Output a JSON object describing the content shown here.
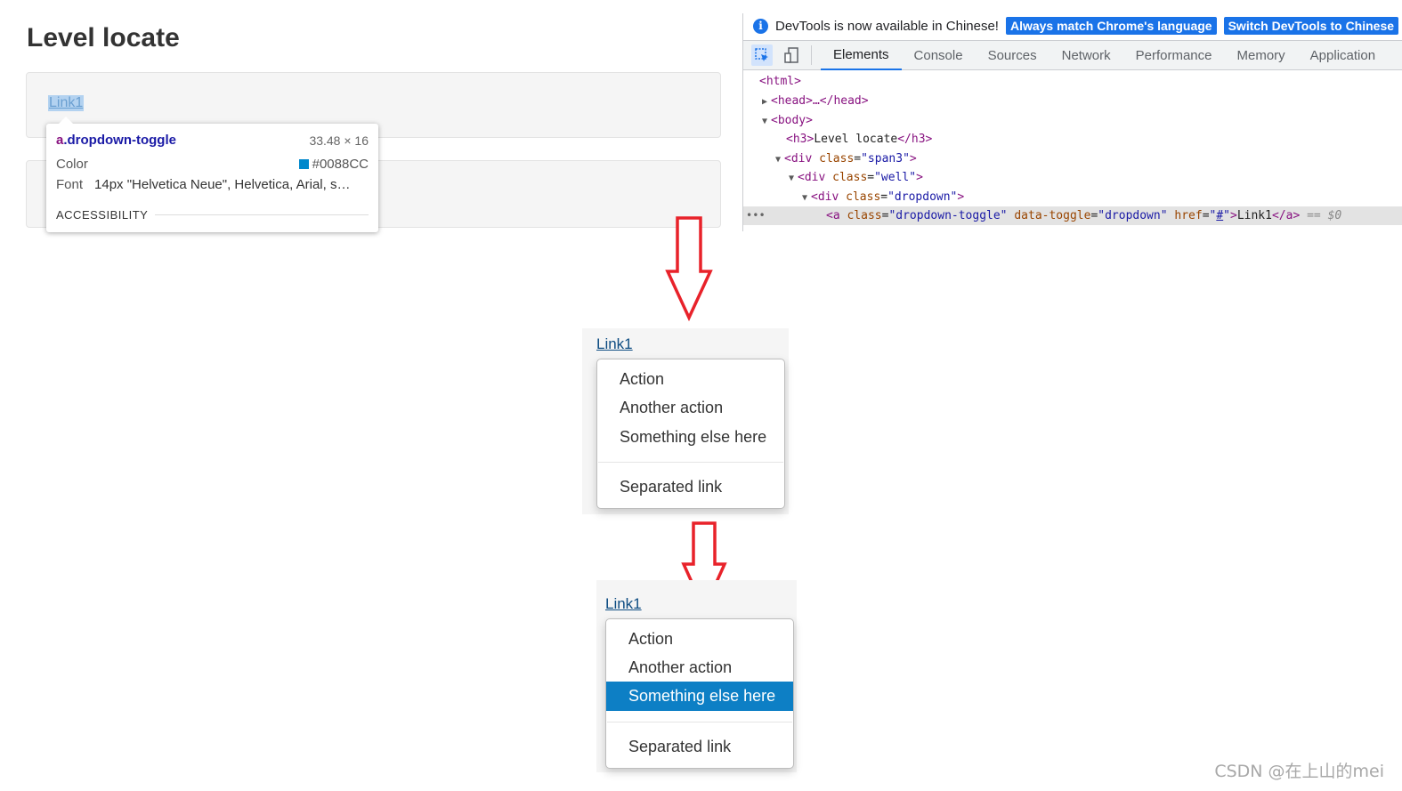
{
  "page": {
    "title": "Level locate",
    "link_label": "Link1"
  },
  "tooltip": {
    "tag": "a",
    "class_name": ".dropdown-toggle",
    "size": "33.48 × 16",
    "color_label": "Color",
    "color_value": "#0088CC",
    "font_label": "Font",
    "font_value": "14px \"Helvetica Neue\", Helvetica, Arial, s…",
    "accessibility_label": "ACCESSIBILITY"
  },
  "devtools": {
    "info_text": "DevTools is now available in Chinese!",
    "btn_match": "Always match Chrome's language",
    "btn_switch": "Switch DevTools to Chinese",
    "tabs": [
      "Elements",
      "Console",
      "Sources",
      "Network",
      "Performance",
      "Memory",
      "Application"
    ],
    "active_tab": "Elements",
    "dom": {
      "html": "<html>",
      "head": "<head>…</head>",
      "body": "<body>",
      "h3_open": "<h3>",
      "h3_text": "Level locate",
      "h3_close": "</h3>",
      "div": "<div",
      "class_attr": "class",
      "span3": "\"span3\"",
      "well": "\"well\"",
      "dropdown": "\"dropdown\"",
      "a_open": "<a",
      "a_class_val": "\"dropdown-toggle\"",
      "data_toggle_attr": "data-toggle",
      "data_toggle_val": "\"dropdown\"",
      "href_attr": "href",
      "href_val": "#",
      "a_text": "Link1",
      "a_close": "</a>",
      "sel_marker": "== $0",
      "gt": ">",
      "eq": "=",
      "quote": "\""
    }
  },
  "dropdown": {
    "link": "Link1",
    "items": [
      "Action",
      "Another action",
      "Something else here"
    ],
    "separated": "Separated link",
    "highlight_color": "#0d7fc5"
  },
  "watermark": "CSDN @在上山的mei"
}
